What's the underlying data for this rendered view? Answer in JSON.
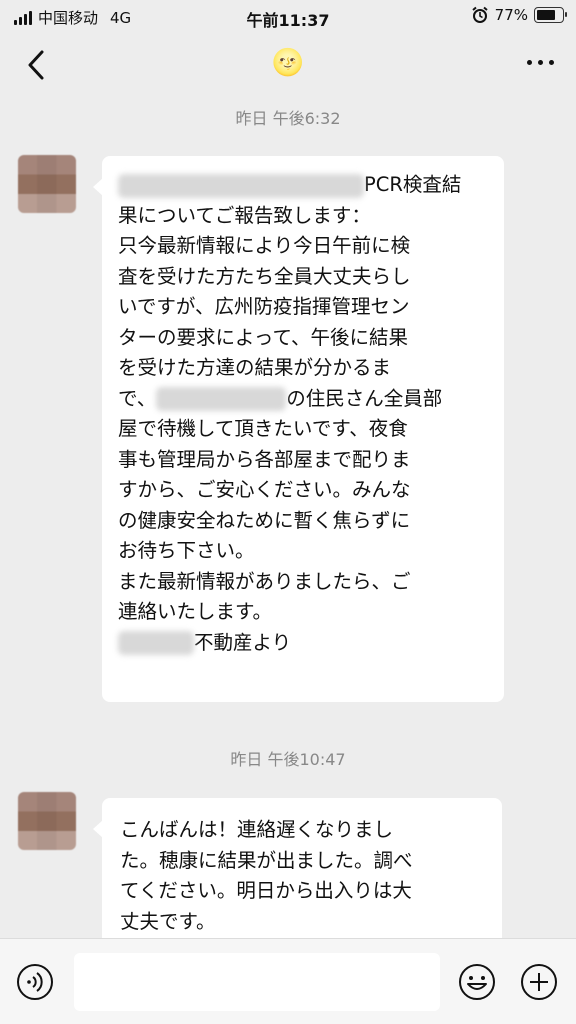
{
  "status_bar": {
    "carrier": "中国移动",
    "network": "4G",
    "time": "午前11:37",
    "battery_text": "77%",
    "battery_level": 0.77
  },
  "nav": {
    "title_emoji": "🌝"
  },
  "messages": [
    {
      "timestamp": "昨日 午後6:32",
      "lines": [
        {
          "pre": "",
          "post": "PCR検査結"
        },
        {
          "text": "果についてご報告致します："
        },
        {
          "text": "只今最新情報により今日午前に検"
        },
        {
          "text": "査を受けた方たち全員大丈夫らし"
        },
        {
          "text": "いですが、広州防疫指揮管理セン"
        },
        {
          "text": "ターの要求によって、午後に結果"
        },
        {
          "text": "を受けた方達の結果が分かるま"
        },
        {
          "pre": "で、",
          "post": "の住民さん全員部"
        },
        {
          "text": "屋で待機して頂きたいです、夜食"
        },
        {
          "text": "事も管理局から各部屋まで配りま"
        },
        {
          "text": "すから、ご安心ください。みんな"
        },
        {
          "text": "の健康安全ねために暫く焦らずに"
        },
        {
          "text": "お待ち下さい。"
        },
        {
          "text": "また最新情報がありましたら、ご"
        },
        {
          "text": "連絡いたします。"
        },
        {
          "pre": "",
          "post": "不動産より"
        }
      ]
    },
    {
      "timestamp": "昨日 午後10:47",
      "lines": [
        {
          "text": "こんばんは！連絡遅くなりまし"
        },
        {
          "text": "た。穂康に結果が出ました。調べ"
        },
        {
          "text": "てください。明日から出入りは大"
        },
        {
          "text": "丈夫です。"
        }
      ]
    }
  ],
  "input": {
    "value": ""
  },
  "icons": {
    "back": "chevron-left-icon",
    "more": "more-icon",
    "voice": "voice-icon",
    "emoji": "emoji-icon",
    "plus": "plus-icon"
  }
}
